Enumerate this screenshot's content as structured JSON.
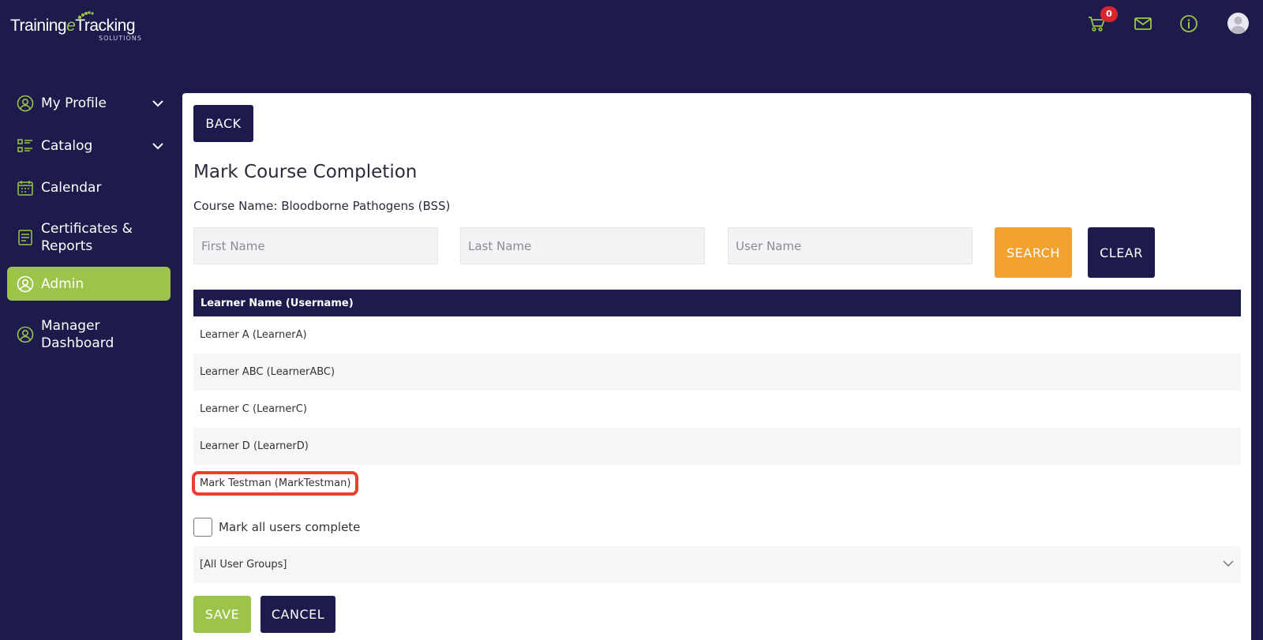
{
  "header": {
    "logo": {
      "part1": "Training",
      "part2": "e",
      "part3": "Tracking",
      "sub": "SOLUTIONS"
    },
    "cart_count": "0",
    "icons": [
      "cart-icon",
      "mail-icon",
      "info-icon",
      "avatar"
    ]
  },
  "sidebar": {
    "items": [
      {
        "label": "My Profile",
        "icon": "user-circle-icon",
        "has_chevron": true
      },
      {
        "label": "Catalog",
        "icon": "list-icon",
        "has_chevron": true
      },
      {
        "label": "Calendar",
        "icon": "calendar-icon",
        "has_chevron": false
      },
      {
        "label": "Certificates & Reports",
        "line1": "Certificates &",
        "line2": "Reports",
        "icon": "report-icon",
        "has_chevron": false
      },
      {
        "label": "Admin",
        "icon": "user-circle-icon",
        "active": true
      },
      {
        "label": "Manager Dashboard",
        "line1": "Manager",
        "line2": "Dashboard",
        "icon": "user-circle-icon"
      }
    ]
  },
  "main": {
    "back_label": "BACK",
    "title": "Mark Course Completion",
    "course_name": "Course Name: Bloodborne Pathogens (BSS)",
    "search": {
      "first_name_placeholder": "First Name",
      "last_name_placeholder": "Last Name",
      "user_name_placeholder": "User Name",
      "search_label": "SEARCH",
      "clear_label": "CLEAR"
    },
    "table": {
      "header": "Learner Name (Username)",
      "rows": [
        "Learner A (LearnerA)",
        "Learner ABC (LearnerABC)",
        "Learner C (LearnerC)",
        "Learner D (LearnerD)",
        "Mark Testman (MarkTestman)"
      ]
    },
    "mark_all_label": "Mark all users complete",
    "user_group_selected": "[All User Groups]",
    "save_label": "SAVE",
    "cancel_label": "CANCEL"
  },
  "colors": {
    "navy": "#1d1b4c",
    "accent_green": "#9cc44a",
    "orange": "#f3a12f",
    "badge_red": "#d9262e",
    "highlight_red": "#e8402a"
  }
}
